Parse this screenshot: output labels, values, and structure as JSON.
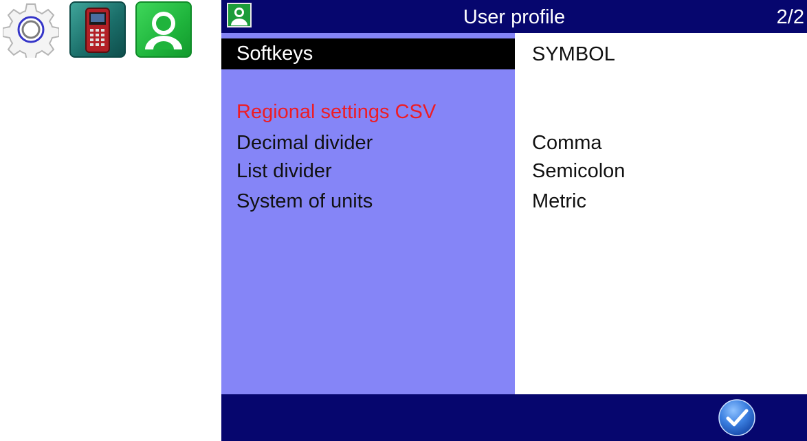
{
  "sidebar": {
    "icons": [
      {
        "name": "settings-gear-icon"
      },
      {
        "name": "device-icon"
      },
      {
        "name": "user-profile-icon"
      }
    ]
  },
  "header": {
    "icon": "user-profile-icon",
    "title": "User profile",
    "page": "2/2"
  },
  "settings": {
    "selected": {
      "label": "Softkeys",
      "value": "SYMBOL"
    },
    "section_heading": "Regional settings CSV",
    "rows": [
      {
        "label": "Decimal divider",
        "value": "Comma"
      },
      {
        "label": "List divider",
        "value": "Semicolon"
      },
      {
        "label": "System of units",
        "value": "Metric"
      }
    ]
  },
  "footer": {
    "ok_icon": "checkmark-icon"
  },
  "colors": {
    "bar": "#06066e",
    "panel": "#8585f7",
    "heading": "#ee1c24",
    "selected_bg": "#000000"
  }
}
